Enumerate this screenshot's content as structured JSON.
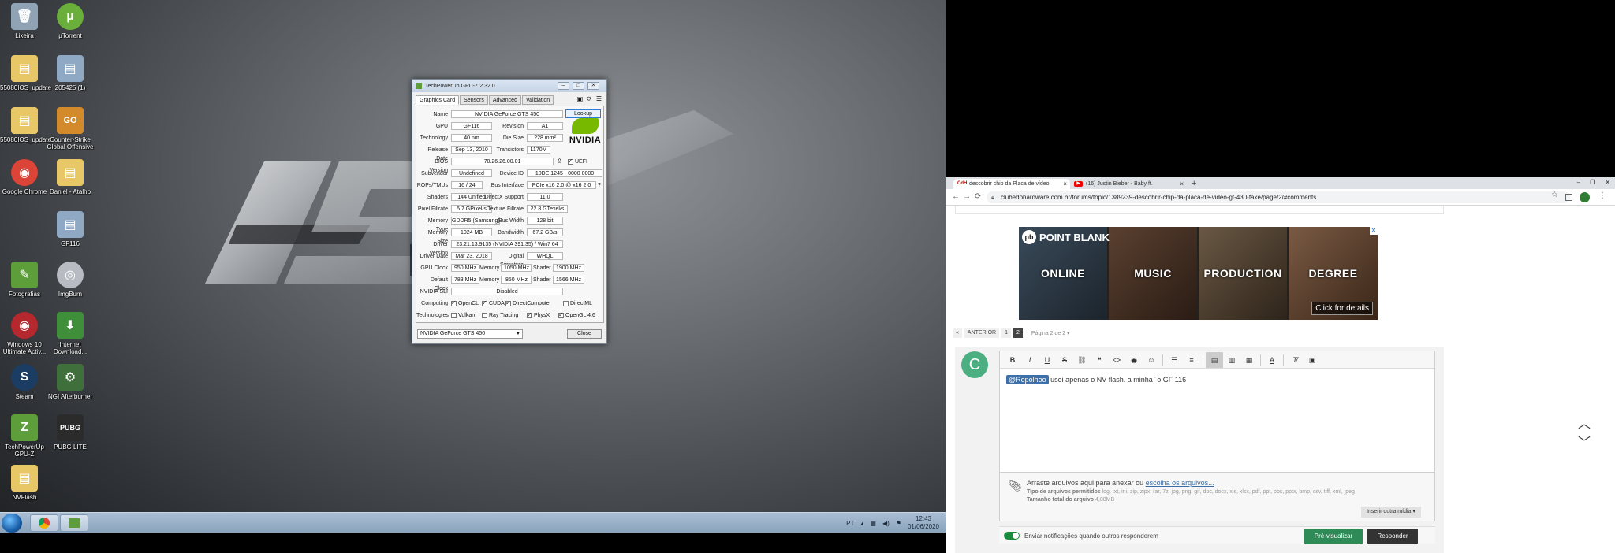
{
  "desktop": {
    "icons": [
      {
        "label": "Lixeira",
        "color": "#8fa3b5",
        "glyph": "🗑"
      },
      {
        "label": "µTorrent",
        "color": "#6aae3c",
        "glyph": "µ"
      },
      {
        "label": "55080IOS_update",
        "color": "#e7c766",
        "glyph": "▤"
      },
      {
        "label": "205425 (1)",
        "color": "#8fa9c4",
        "glyph": "▤"
      },
      {
        "label": "55080IOS_update",
        "color": "#e7c766",
        "glyph": "▤"
      },
      {
        "label": "Counter-Strike Global Offensive",
        "color": "#d28a2b",
        "glyph": "GO"
      },
      {
        "label": "Google Chrome",
        "color": "#db4437",
        "glyph": "◉"
      },
      {
        "label": "Daniel - Atalho",
        "color": "#e7c766",
        "glyph": "▤"
      },
      {
        "label": "GF116",
        "color": "#8fa9c4",
        "glyph": "▤"
      },
      {
        "label": "Fotografias",
        "color": "#5d9e3a",
        "glyph": "✎"
      },
      {
        "label": "ImgBurn",
        "color": "#b8bcc2",
        "glyph": "◎"
      },
      {
        "label": "Windows 10 Ultimate Activ...",
        "color": "#b4282e",
        "glyph": "◉"
      },
      {
        "label": "Internet Download...",
        "color": "#3f8f3a",
        "glyph": "⬇"
      },
      {
        "label": "Steam",
        "color": "#1b3d63",
        "glyph": "S"
      },
      {
        "label": "NGI Afterburner",
        "color": "#3f6f3a",
        "glyph": "⚙"
      },
      {
        "label": "TechPowerUp GPU-Z",
        "color": "#5d9e3a",
        "glyph": "Z"
      },
      {
        "label": "PUBG LITE",
        "color": "#2b2b2b",
        "glyph": "PUBG"
      },
      {
        "label": "NVFlash",
        "color": "#e7c766",
        "glyph": "▤"
      }
    ],
    "taskbar": {
      "lang": "PT",
      "time": "12:43",
      "date": "01/06/2020"
    }
  },
  "gpuz": {
    "title": "TechPowerUp GPU-Z 2.32.0",
    "tabs": [
      "Graphics Card",
      "Sensors",
      "Advanced",
      "Validation"
    ],
    "lookup": "Lookup",
    "nvidia": "NVIDIA",
    "fields": {
      "name_lbl": "Name",
      "name": "NVIDIA GeForce GTS 450",
      "gpu_lbl": "GPU",
      "gpu": "GF116",
      "revision_lbl": "Revision",
      "revision": "A1",
      "tech_lbl": "Technology",
      "tech": "40 nm",
      "diesize_lbl": "Die Size",
      "diesize": "228 mm²",
      "release_lbl": "Release Date",
      "release": "Sep 13, 2010",
      "transistors_lbl": "Transistors",
      "transistors": "1170M",
      "bios_lbl": "BIOS Version",
      "bios": "70.26.26.00.01",
      "uefi": "UEFI",
      "subvendor_lbl": "Subvendor",
      "subvendor": "Undefined",
      "deviceid_lbl": "Device ID",
      "deviceid": "10DE 1245 - 0000 0000",
      "rops_lbl": "ROPs/TMUs",
      "rops": "16 / 24",
      "bus_lbl": "Bus Interface",
      "bus": "PCIe x16 2.0 @ x16 2.0",
      "shaders_lbl": "Shaders",
      "shaders": "144 Unified",
      "dx_lbl": "DirectX Support",
      "dx": "11.0",
      "pixel_lbl": "Pixel Fillrate",
      "pixel": "5.7 GPixel/s",
      "texture_lbl": "Texture Fillrate",
      "texture": "22.8 GTexel/s",
      "memtype_lbl": "Memory Type",
      "memtype": "GDDR5 (Samsung)",
      "buswidth_lbl": "Bus Width",
      "buswidth": "128 bit",
      "memsize_lbl": "Memory Size",
      "memsize": "1024 MB",
      "bandwidth_lbl": "Bandwidth",
      "bandwidth": "67.2 GB/s",
      "driver_lbl": "Driver Version",
      "driver": "23.21.13.9135 (NVIDIA 391.35) / Win7 64",
      "driverdate_lbl": "Driver Date",
      "driverdate": "Mar 23, 2018",
      "sig_lbl": "Digital Signature",
      "sig": "WHQL",
      "gpuclock_lbl": "GPU Clock",
      "gpuclock": "950 MHz",
      "mem_lbl": "Memory",
      "memclock": "1050 MHz",
      "shader_lbl": "Shader",
      "shaderclock": "1900 MHz",
      "defclock_lbl": "Default Clock",
      "defclock": "783 MHz",
      "defmem": "850 MHz",
      "defshader": "1566 MHz",
      "sli_lbl": "NVIDIA SLI",
      "sli": "Disabled",
      "computing_lbl": "Computing",
      "technologies_lbl": "Technologies"
    },
    "computing": [
      {
        "label": "OpenCL",
        "checked": true
      },
      {
        "label": "CUDA",
        "checked": true
      },
      {
        "label": "DirectCompute",
        "checked": true
      },
      {
        "label": "DirectML",
        "checked": false
      }
    ],
    "technologies": [
      {
        "label": "Vulkan",
        "checked": false
      },
      {
        "label": "Ray Tracing",
        "checked": false
      },
      {
        "label": "PhysX",
        "checked": true
      },
      {
        "label": "OpenGL 4.6",
        "checked": true
      }
    ],
    "select": "NVIDIA GeForce GTS 450",
    "close": "Close"
  },
  "browser": {
    "tabs": [
      {
        "label": "descobrir chip da Placa de vídeo",
        "fav": "CdH",
        "active": true
      },
      {
        "label": "(16) Justin Bieber - Baby ft.",
        "fav": "▶",
        "active": false
      }
    ],
    "url": "clubedohardware.com.br/forums/topic/1389239-descobrir-chip-da-placa-de-video-gt-430-fake/page/2/#comments",
    "ad": {
      "brand": "POINT BLANK",
      "panels": [
        "ONLINE",
        "MUSIC",
        "PRODUCTION",
        "DEGREE"
      ],
      "cta": "Click for details"
    },
    "pager": {
      "prev": "ANTERIOR",
      "pages": [
        "1",
        "2"
      ],
      "current": "2",
      "jump": "Página 2 de 2"
    },
    "reply": {
      "avatar": "C",
      "mention": "@Repolhoo",
      "text": " usei apenas o NV flash. a minha ´o GF 116",
      "attach_prompt": "Arraste arquivos aqui para anexar ou ",
      "attach_link": "escolha os arquivos...",
      "allowed_lbl": "Tipo de arquivos permitidos",
      "allowed": "log, txt, ini, zip, zipx, rar, 7z, jpg, png, gif, doc, docx, xls, xlsx, pdf, ppt, pps, pptx, bmp, csv, tiff, xml, jpeg",
      "size_lbl": "Tamanho total do arquivo",
      "size": "4,88MB",
      "insert_media": "Inserir outra mídia ▾",
      "notify": "Enviar notificações quando outros responderem",
      "preview": "Pré-visualizar",
      "submit": "Responder"
    }
  }
}
